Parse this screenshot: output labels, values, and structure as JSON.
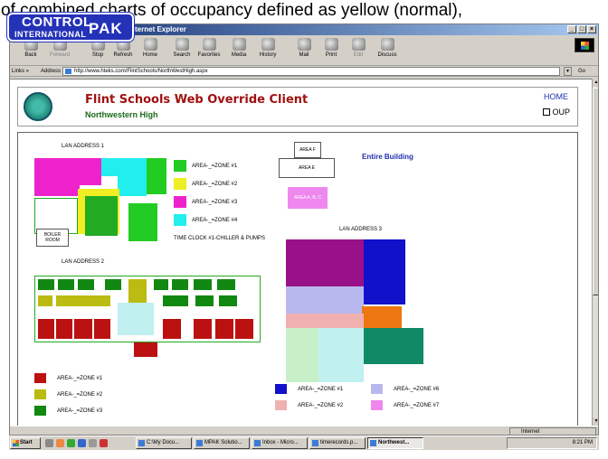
{
  "caption": "of combined charts of occupancy defined as yellow (normal),",
  "window": {
    "title": "Northwestern High - Microsoft Internet Explorer"
  },
  "logo": {
    "line1": "CONTROL",
    "line2": "INTERNATIONAL",
    "line3": "PAK"
  },
  "toolbar": {
    "buttons": [
      "Back",
      "Forward",
      "Stop",
      "Refresh",
      "Home",
      "Search",
      "Favorites",
      "Media",
      "History",
      "Mail",
      "Print",
      "Edit",
      "Discuss"
    ]
  },
  "addressbar": {
    "links_label": "Links »",
    "address_label": "Address",
    "url": "http://www.hteks.com/FlintSchools/NorthWestHigh.aspx",
    "go_label": "Go"
  },
  "header": {
    "title": "Flint Schools Web Override Client",
    "subtitle": "Northwestern High",
    "home_link": "HOME",
    "oup_label": "OUP"
  },
  "map": {
    "lan1": "LAN ADDRESS 1",
    "lan2": "LAN ADDRESS 2",
    "lan3": "LAN ADDRESS 3",
    "entire_building": "Entire Building",
    "boiler_room": "BOILER ROOM",
    "area_f": "AREA F",
    "area_e": "AREA E",
    "area_abc": "AREA A, B, C",
    "time_clock": "TIME CLOCK #1-CHILLER & PUMPS",
    "legend1": [
      {
        "label": "AREA-_=ZONE #1",
        "color": "#22cc22"
      },
      {
        "label": "AREA-_=ZONE #2",
        "color": "#eeee22"
      },
      {
        "label": "AREA-_=ZONE #3",
        "color": "#ee22cc"
      },
      {
        "label": "AREA-_=ZONE #4",
        "color": "#22eeee"
      }
    ],
    "legend2": [
      {
        "label": "AREA-_=ZONE #1",
        "color": "#bb1111"
      },
      {
        "label": "AREA-_=ZONE #2",
        "color": "#bbbb11"
      },
      {
        "label": "AREA-_=ZONE #3",
        "color": "#118811"
      }
    ],
    "legend3": [
      {
        "label": "AREA-_=ZONE #1",
        "color": "#1111cc"
      },
      {
        "label": "AREA-_=ZONE #2",
        "color": "#f0b0b0"
      },
      {
        "label": "AREA-_=ZONE #6",
        "color": "#b8b8ee"
      },
      {
        "label": "AREA-_=ZONE #7",
        "color": "#ee88ee"
      }
    ]
  },
  "statusbar": {
    "zone": "Internet"
  },
  "taskbar": {
    "start": "Start",
    "tasks": [
      "C:\\My Docu...",
      "MPAK Solutio...",
      "Inbox - Micro...",
      "timerecords.p...",
      "Northwest..."
    ],
    "clock": "8:21 PM"
  }
}
